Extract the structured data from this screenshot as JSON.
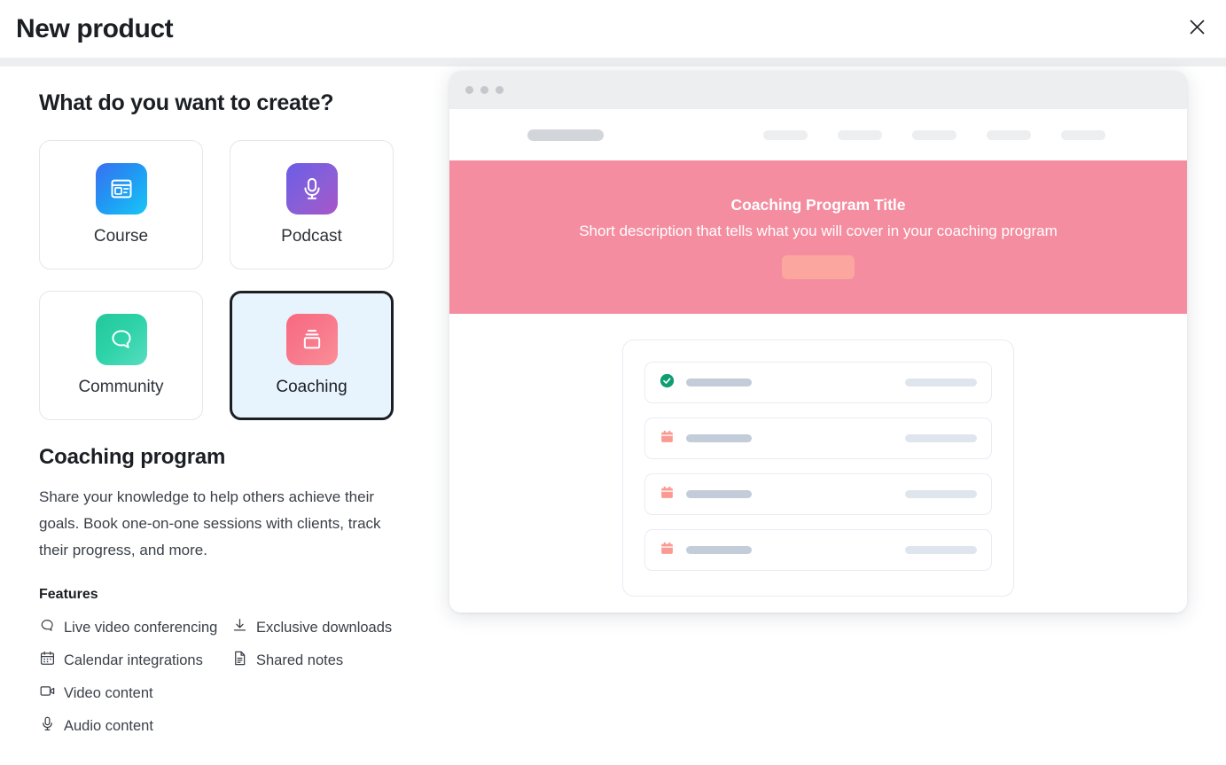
{
  "header": {
    "title": "New product",
    "close_label": "Close"
  },
  "left": {
    "question": "What do you want to create?",
    "types": [
      {
        "label": "Course",
        "icon": "course-window-icon",
        "selected": false
      },
      {
        "label": "Podcast",
        "icon": "podcast-mic-icon",
        "selected": false
      },
      {
        "label": "Community",
        "icon": "community-chat-icon",
        "selected": false
      },
      {
        "label": "Coaching",
        "icon": "coaching-board-icon",
        "selected": true
      }
    ],
    "detail": {
      "title": "Coaching program",
      "description": "Share your knowledge to help others achieve their goals. Book one-on-one sessions with clients, track their progress, and more."
    },
    "features_heading": "Features",
    "features": [
      {
        "label": "Live video conferencing",
        "icon": "chat-bubble-icon"
      },
      {
        "label": "Exclusive downloads",
        "icon": "download-icon"
      },
      {
        "label": "Calendar integrations",
        "icon": "calendar-icon"
      },
      {
        "label": "Shared notes",
        "icon": "document-icon"
      },
      {
        "label": "Video content",
        "icon": "video-camera-icon"
      },
      {
        "label": "Audio content",
        "icon": "microphone-icon"
      }
    ]
  },
  "preview": {
    "hero": {
      "title": "Coaching Program Title",
      "description": "Short description that tells what you will cover in your coaching program"
    },
    "sessions": [
      {
        "status_icon": "check-circle-icon"
      },
      {
        "status_icon": "calendar-icon"
      },
      {
        "status_icon": "calendar-icon"
      },
      {
        "status_icon": "calendar-icon"
      }
    ],
    "nav_link_count": 5
  },
  "colors": {
    "accent_pink": "#f48da0",
    "selected_bg": "#e7f3fd",
    "selected_border": "#1b1f24",
    "check_green": "#0f9e72",
    "calendar_salmon": "#f99b93"
  }
}
